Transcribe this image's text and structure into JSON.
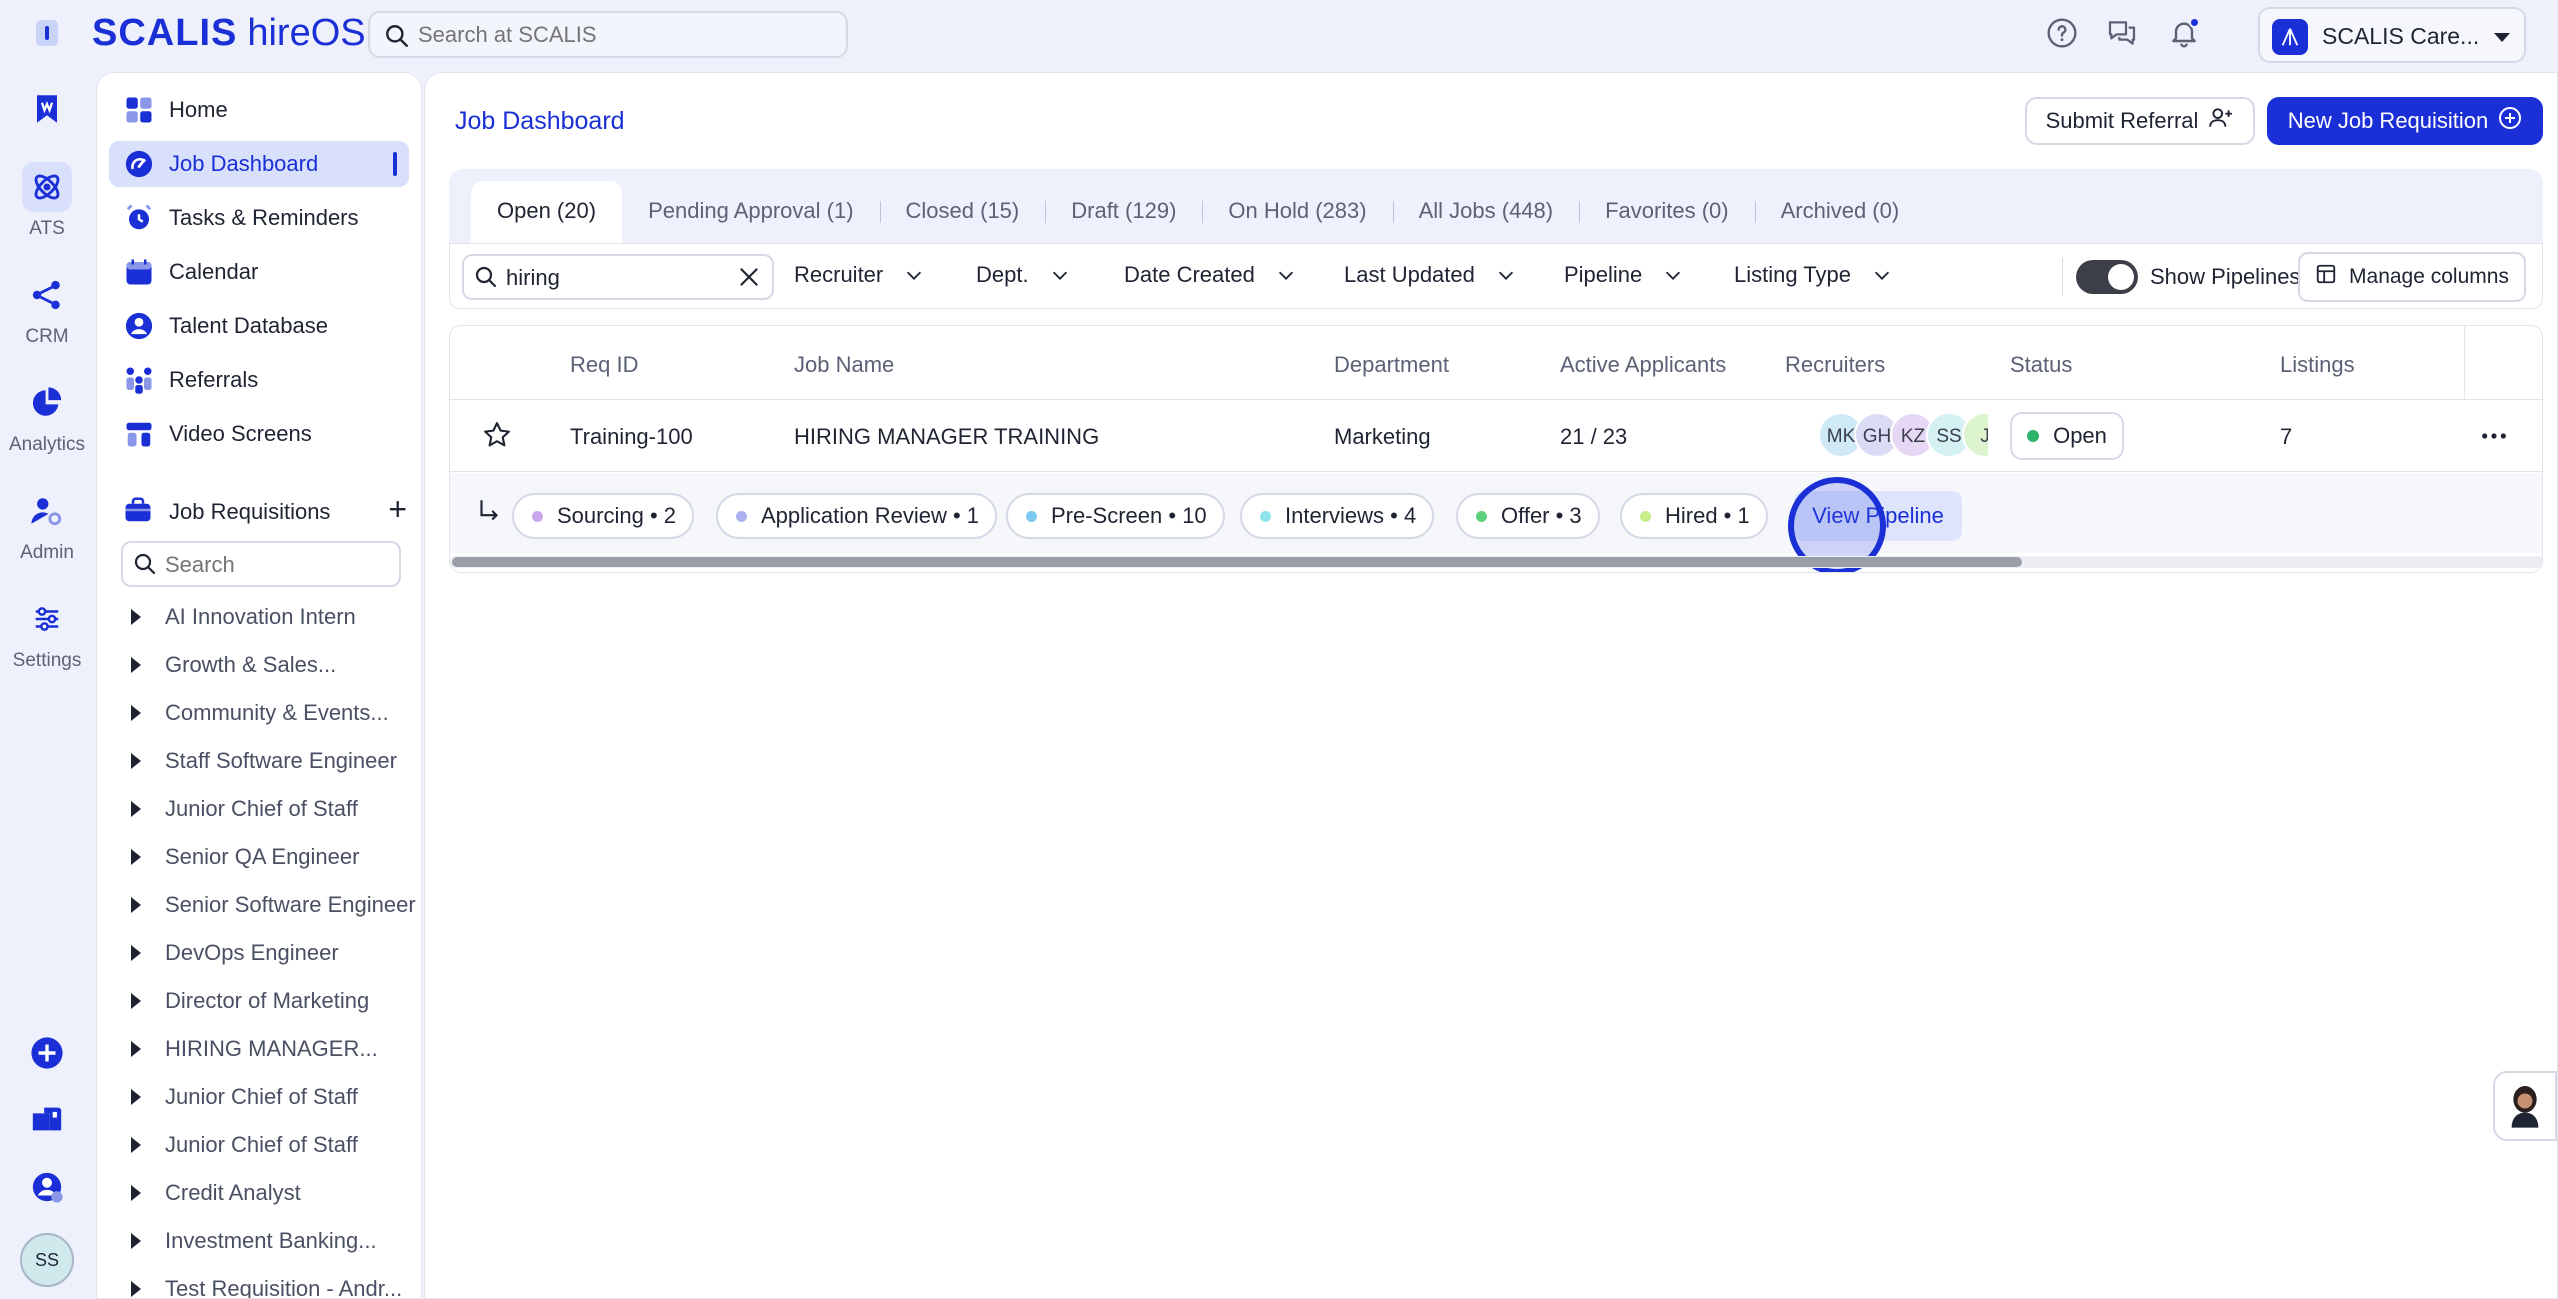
{
  "app": {
    "brand": "SCALIS",
    "product": "hireOS"
  },
  "topbar": {
    "search_placeholder": "Search at SCALIS",
    "account_name": "SCALIS Care..."
  },
  "rail": {
    "items": [
      {
        "label": "ATS"
      },
      {
        "label": "CRM"
      },
      {
        "label": "Analytics"
      },
      {
        "label": "Admin"
      },
      {
        "label": "Settings"
      }
    ],
    "user_initials": "SS"
  },
  "sidebar": {
    "nav": [
      {
        "label": "Home"
      },
      {
        "label": "Job Dashboard"
      },
      {
        "label": "Tasks & Reminders"
      },
      {
        "label": "Calendar"
      },
      {
        "label": "Talent Database"
      },
      {
        "label": "Referrals"
      },
      {
        "label": "Video Screens"
      }
    ],
    "requisitions_title": "Job Requisitions",
    "search_placeholder": "Search",
    "requisitions": [
      "AI Innovation Intern",
      "Growth & Sales...",
      "Community & Events...",
      "Staff Software Engineer",
      "Junior Chief of Staff",
      "Senior QA Engineer",
      "Senior Software Engineer",
      "DevOps Engineer",
      "Director of Marketing",
      "HIRING MANAGER...",
      "Junior Chief of Staff",
      "Junior Chief of Staff",
      "Credit Analyst",
      "Investment Banking...",
      "Test Requisition - Andr..."
    ]
  },
  "main": {
    "title": "Job Dashboard",
    "submit_referral": "Submit Referral",
    "new_requisition": "New Job Requisition",
    "tabs": [
      "Open (20)",
      "Pending Approval (1)",
      "Closed (15)",
      "Draft (129)",
      "On Hold (283)",
      "All Jobs (448)",
      "Favorites (0)",
      "Archived (0)"
    ],
    "filters": {
      "search_value": "hiring",
      "dropdowns": [
        "Recruiter",
        "Dept.",
        "Date Created",
        "Last Updated",
        "Pipeline",
        "Listing Type"
      ],
      "show_pipelines_label": "Show Pipelines",
      "show_pipelines_on": true,
      "manage_columns": "Manage columns"
    },
    "table": {
      "columns": [
        "Req ID",
        "Job Name",
        "Department",
        "Active Applicants",
        "Recruiters",
        "Status",
        "Listings"
      ],
      "row": {
        "req_id": "Training-100",
        "job_name": "HIRING MANAGER TRAINING",
        "department": "Marketing",
        "active_applicants": "21 / 23",
        "recruiters": [
          "MK",
          "GH",
          "KZ",
          "SS",
          "J"
        ],
        "status": "Open",
        "listings": "7"
      },
      "pipeline": [
        {
          "label": "Sourcing • 2",
          "color": "#c9a6ec"
        },
        {
          "label": "Application Review • 1",
          "color": "#a9b0ef"
        },
        {
          "label": "Pre-Screen • 10",
          "color": "#7ec8ef"
        },
        {
          "label": "Interviews • 4",
          "color": "#8fe3ec"
        },
        {
          "label": "Offer • 3",
          "color": "#5fd07c"
        },
        {
          "label": "Hired • 1",
          "color": "#c5ee8a"
        }
      ],
      "view_pipeline": "View Pipeline"
    }
  },
  "colors": {
    "accent": "#1a2fd6",
    "status_open": "#2fb36b"
  }
}
